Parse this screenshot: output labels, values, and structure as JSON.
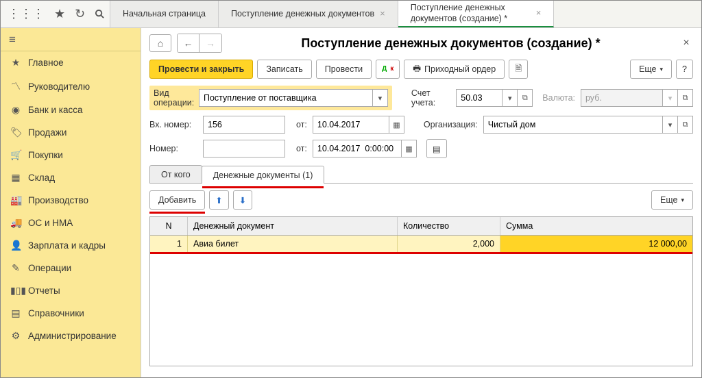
{
  "tabs": {
    "items": [
      {
        "label": "Начальная страница",
        "closable": false
      },
      {
        "label": "Поступление денежных документов",
        "closable": true
      },
      {
        "label": "Поступление денежных документов (создание) *",
        "closable": true
      }
    ],
    "active_index": 2
  },
  "sidebar": {
    "items": [
      {
        "label": "Главное",
        "icon": "star"
      },
      {
        "label": "Руководителю",
        "icon": "trend"
      },
      {
        "label": "Банк и касса",
        "icon": "coins"
      },
      {
        "label": "Продажи",
        "icon": "tag"
      },
      {
        "label": "Покупки",
        "icon": "cart"
      },
      {
        "label": "Склад",
        "icon": "boxes"
      },
      {
        "label": "Производство",
        "icon": "factory"
      },
      {
        "label": "ОС и НМА",
        "icon": "truck"
      },
      {
        "label": "Зарплата и кадры",
        "icon": "person"
      },
      {
        "label": "Операции",
        "icon": "manual"
      },
      {
        "label": "Отчеты",
        "icon": "chart"
      },
      {
        "label": "Справочники",
        "icon": "book"
      },
      {
        "label": "Администрирование",
        "icon": "gear"
      }
    ]
  },
  "page": {
    "title": "Поступление денежных документов (создание) *"
  },
  "toolbar": {
    "primary": "Провести и закрыть",
    "write": "Записать",
    "post": "Провести",
    "cash_order": "Приходный ордер",
    "more": "Еще",
    "help": "?"
  },
  "form": {
    "op_type_label": "Вид операции:",
    "op_type_value": "Поступление от поставщика",
    "account_label": "Счет учета:",
    "account_value": "50.03",
    "currency_label": "Валюта:",
    "currency_value": "руб.",
    "in_num_label": "Вх. номер:",
    "in_num_value": "156",
    "in_num_date_label": "от:",
    "in_num_date_value": "10.04.2017",
    "org_label": "Организация:",
    "org_value": "Чистый дом",
    "num_label": "Номер:",
    "num_value": "",
    "num_date_label": "от:",
    "num_date_value": "10.04.2017  0:00:00"
  },
  "tabstrip": {
    "tabs": [
      {
        "label": "От кого"
      },
      {
        "label": "Денежные документы (1)"
      }
    ],
    "active_index": 1
  },
  "grid_toolbar": {
    "add": "Добавить",
    "more": "Еще"
  },
  "grid": {
    "header": {
      "n": "N",
      "doc": "Денежный документ",
      "qty": "Количество",
      "sum": "Сумма"
    },
    "rows": [
      {
        "n": "1",
        "doc": "Авиа билет",
        "qty": "2,000",
        "sum": "12 000,00"
      }
    ]
  }
}
